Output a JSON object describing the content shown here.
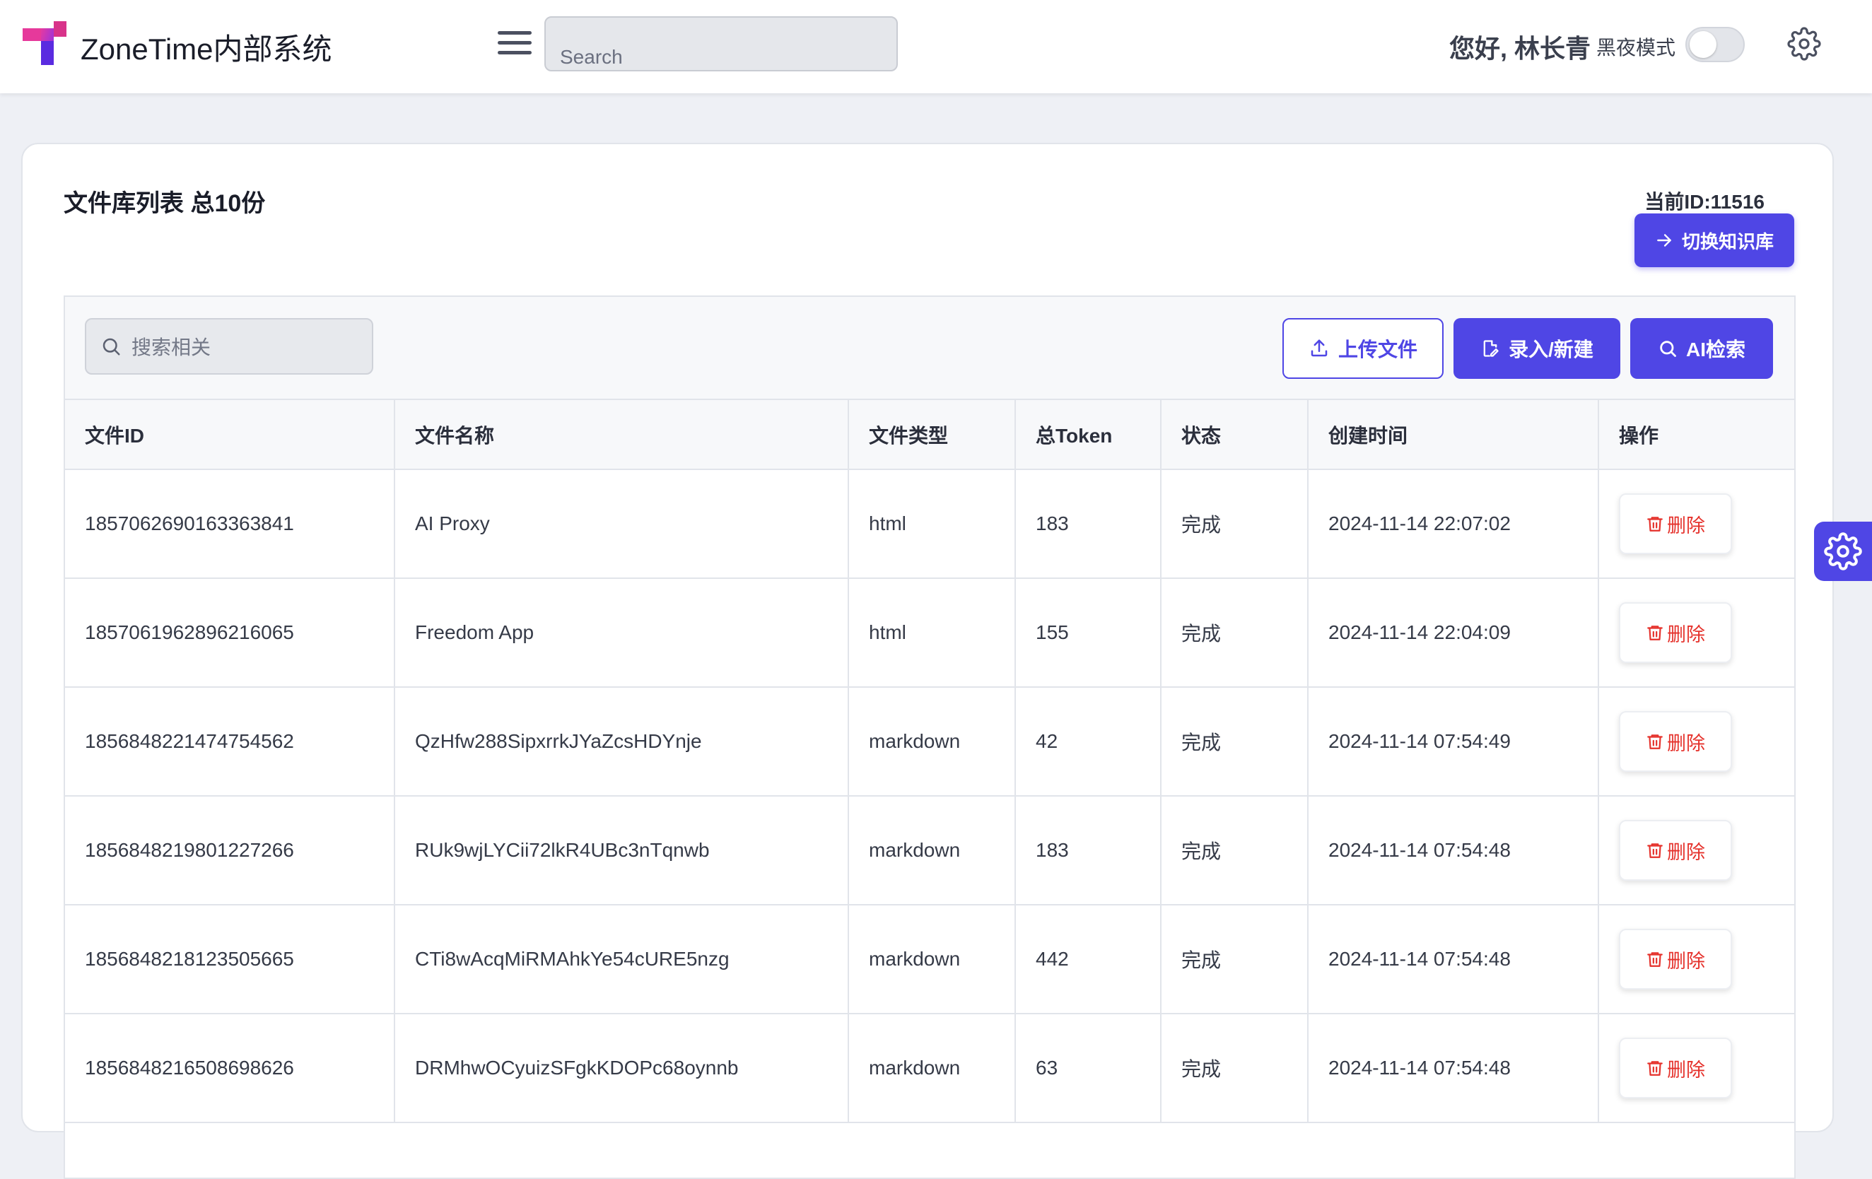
{
  "header": {
    "app_title": "ZoneTime内部系统",
    "search_placeholder": "Search",
    "greeting": "您好, 林长青",
    "dark_mode_label": "黑夜模式",
    "dark_mode_on": false
  },
  "card": {
    "title": "文件库列表 总10份",
    "current_id": "当前ID:11516",
    "switch_button": "切换知识库"
  },
  "toolbar": {
    "search_placeholder": "搜索相关",
    "upload_label": "上传文件",
    "new_label": "录入/新建",
    "ai_search_label": "AI检索"
  },
  "table": {
    "columns": [
      "文件ID",
      "文件名称",
      "文件类型",
      "总Token",
      "状态",
      "创建时间",
      "操作"
    ],
    "delete_label": "删除",
    "rows": [
      {
        "id": "1857062690163363841",
        "name": "AI Proxy",
        "type": "html",
        "tokens": "183",
        "status": "完成",
        "created": "2024-11-14 22:07:02"
      },
      {
        "id": "1857061962896216065",
        "name": "Freedom App",
        "type": "html",
        "tokens": "155",
        "status": "完成",
        "created": "2024-11-14 22:04:09"
      },
      {
        "id": "1856848221474754562",
        "name": "QzHfw288SipxrrkJYaZcsHDYnje",
        "type": "markdown",
        "tokens": "42",
        "status": "完成",
        "created": "2024-11-14 07:54:49"
      },
      {
        "id": "1856848219801227266",
        "name": "RUk9wjLYCii72lkR4UBc3nTqnwb",
        "type": "markdown",
        "tokens": "183",
        "status": "完成",
        "created": "2024-11-14 07:54:48"
      },
      {
        "id": "1856848218123505665",
        "name": "CTi8wAcqMiRMAhkYe54cURE5nzg",
        "type": "markdown",
        "tokens": "442",
        "status": "完成",
        "created": "2024-11-14 07:54:48"
      },
      {
        "id": "1856848216508698626",
        "name": "DRMhwOCyuizSFgkKDOPc68oynnb",
        "type": "markdown",
        "tokens": "63",
        "status": "完成",
        "created": "2024-11-14 07:54:48"
      }
    ]
  },
  "colors": {
    "accent": "#4f46e5",
    "danger": "#e5312b"
  },
  "icons": [
    "logo-icon",
    "menu-icon",
    "gear-icon",
    "arrow-right-icon",
    "search-icon",
    "upload-icon",
    "edit-icon",
    "trash-icon"
  ]
}
